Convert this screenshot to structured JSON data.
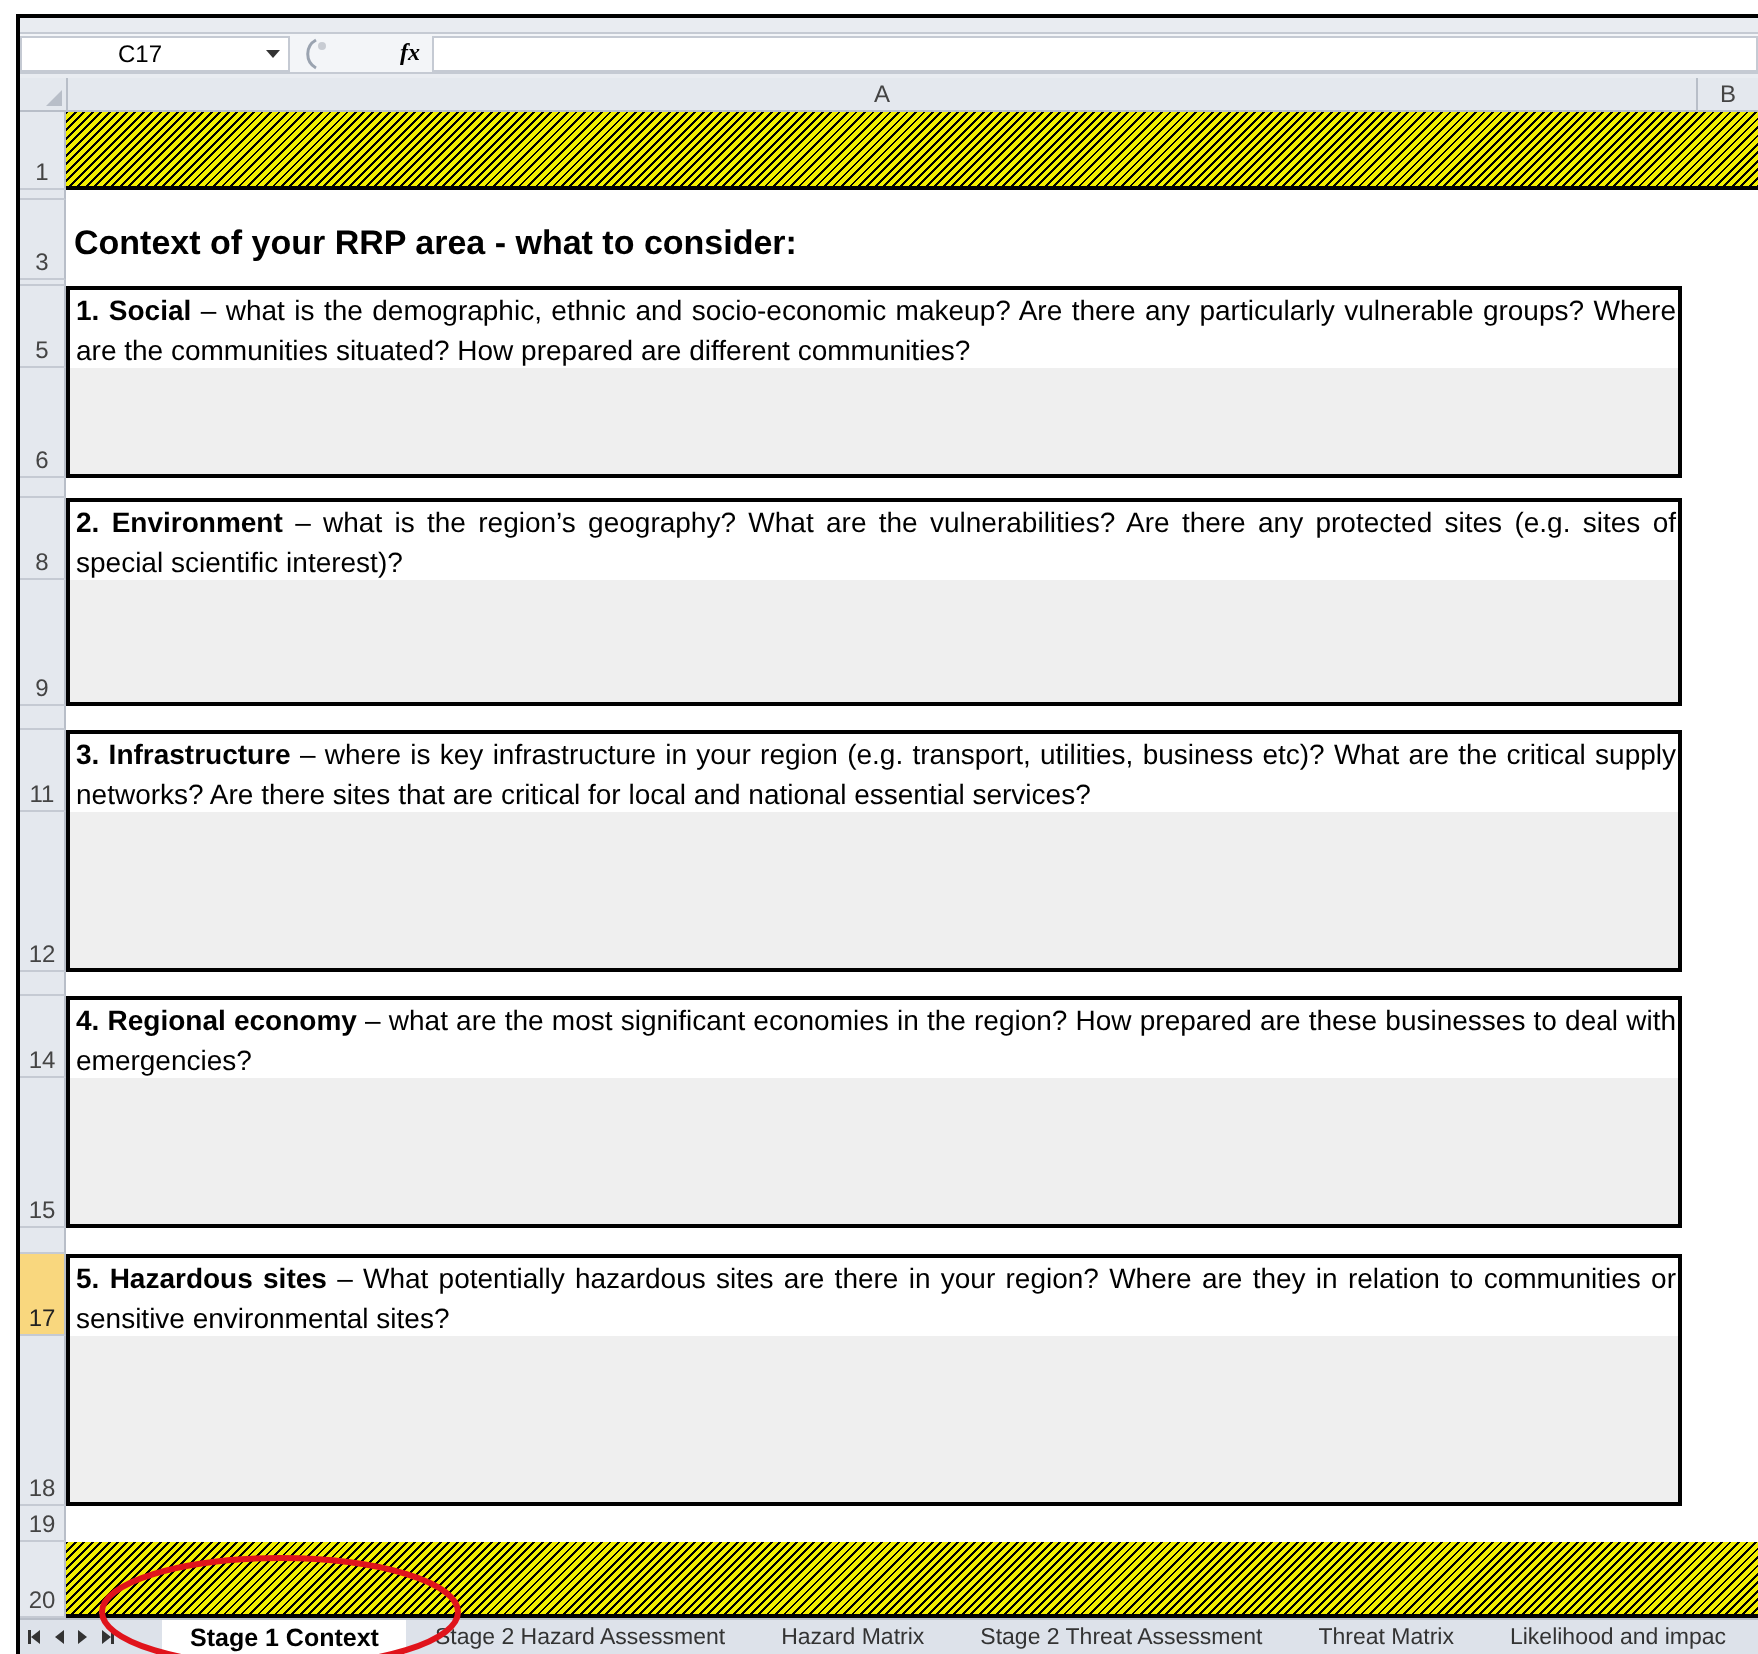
{
  "name_box": {
    "value": "C17"
  },
  "formula_bar": {
    "function_label": "fx"
  },
  "columns": [
    {
      "label": "A"
    },
    {
      "label": "B"
    }
  ],
  "rows": [
    {
      "kind": "banner",
      "number": "1",
      "selected": false
    },
    {
      "kind": "spacer",
      "selected": false
    },
    {
      "kind": "title",
      "number": "3",
      "selected": false,
      "text": "Context of your RRP area - what to consider:"
    },
    {
      "kind": "spacer",
      "selected": false
    },
    {
      "kind": "question",
      "number": "5",
      "selected": false,
      "text": "**1. Social** – what is the demographic, ethnic and socio-economic makeup? Are there any particularly vulnerable groups? Where are the communities situated? How prepared are different communities?"
    },
    {
      "kind": "answer",
      "number": "6",
      "selected": false
    },
    {
      "kind": "spacer",
      "selected": false
    },
    {
      "kind": "question",
      "number": "8",
      "selected": false,
      "text": "**2. Environment** – what is the region’s geography? What are the vulnerabilities? Are there any protected sites (e.g. sites of special scientific interest)?"
    },
    {
      "kind": "answer",
      "number": "9",
      "selected": false
    },
    {
      "kind": "spacer",
      "selected": false
    },
    {
      "kind": "question",
      "number": "11",
      "selected": false,
      "text": "**3. Infrastructure** – where is key infrastructure in your region (e.g. transport, utilities, business etc)? What are the critical supply networks? Are there sites that are critical for local and national essential services?"
    },
    {
      "kind": "answer",
      "number": "12",
      "selected": false
    },
    {
      "kind": "spacer",
      "selected": false
    },
    {
      "kind": "question",
      "number": "14",
      "selected": false,
      "text": "**4. Regional economy** – what are the most significant economies in the region? How prepared are these businesses to deal with emergencies?"
    },
    {
      "kind": "answer",
      "number": "15",
      "selected": false
    },
    {
      "kind": "spacer",
      "selected": false
    },
    {
      "kind": "question",
      "number": "17",
      "selected": true,
      "text": "**5. Hazardous sites** – What potentially hazardous sites are there in your region? Where are they in relation to communities or sensitive environmental sites?"
    },
    {
      "kind": "answer",
      "number": "18",
      "selected": false
    },
    {
      "kind": "blank",
      "number": "19",
      "selected": false
    },
    {
      "kind": "banner",
      "number": "20",
      "selected": false
    }
  ],
  "sheet_tabs": [
    {
      "label": "Stage 1 Context",
      "selected": true
    },
    {
      "label": "Stage 2 Hazard Assessment",
      "selected": false
    },
    {
      "label": "Hazard Matrix",
      "selected": false
    },
    {
      "label": "Stage 2 Threat Assessment",
      "selected": false
    },
    {
      "label": "Threat Matrix",
      "selected": false
    },
    {
      "label": "Likelihood and impac",
      "selected": false
    }
  ]
}
